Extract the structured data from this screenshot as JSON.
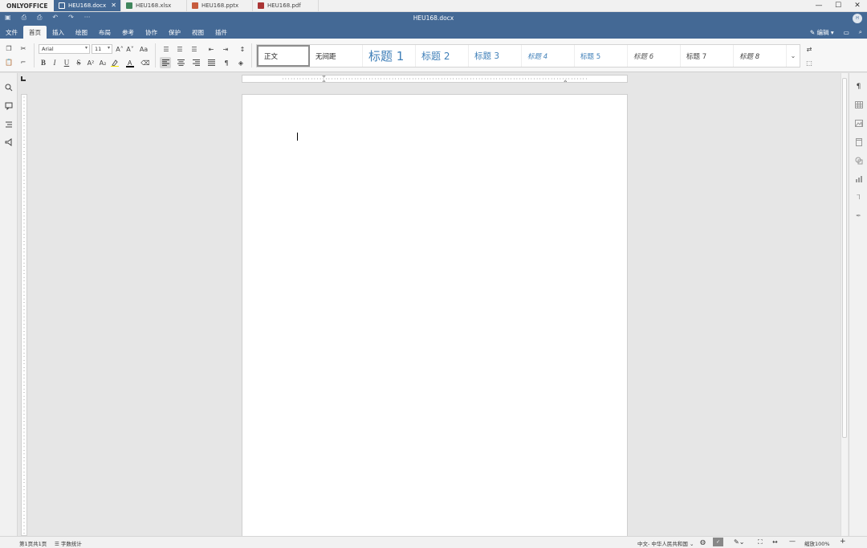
{
  "app": {
    "brand": "ONLYOFFICE"
  },
  "tabs": [
    {
      "label": "HEU168.docx",
      "type": "docx",
      "color": "#446995",
      "active": true
    },
    {
      "label": "HEU168.xlsx",
      "type": "xlsx",
      "color": "#40865c"
    },
    {
      "label": "HEU168.pptx",
      "type": "pptx",
      "color": "#c75b3d"
    },
    {
      "label": "HEU168.pdf",
      "type": "pdf",
      "color": "#aa3535"
    }
  ],
  "window": {
    "title": "HEU168.docx",
    "more": "···",
    "avatar": "H"
  },
  "menu": {
    "items": [
      "文件",
      "首页",
      "插入",
      "绘图",
      "布局",
      "参考",
      "协作",
      "保护",
      "视图",
      "插件"
    ],
    "active": "首页",
    "edit_mode": "编辑"
  },
  "toolbar": {
    "font_name": "Arial",
    "font_size": "11",
    "bold": "B",
    "italic": "I",
    "underline": "U",
    "strike": "S",
    "superscript": "A²",
    "subscript": "A₂",
    "grow": "A˄",
    "shrink": "A˅",
    "case": "Aa"
  },
  "styles": [
    {
      "label": "正文"
    },
    {
      "label": "无间距"
    },
    {
      "label": "标题 1"
    },
    {
      "label": "标题 2"
    },
    {
      "label": "标题 3"
    },
    {
      "label": "标题 4"
    },
    {
      "label": "标题 5"
    },
    {
      "label": "标题 6"
    },
    {
      "label": "标题 7"
    },
    {
      "label": "标题 8"
    }
  ],
  "status": {
    "page": "第1页共1页",
    "word_count": "字数统计",
    "language": "中文- 中华人民共和国",
    "zoom": "缩放100%"
  },
  "colors": {
    "accent": "#446995",
    "page": "#ffffff",
    "canvas": "#e6e6e6"
  }
}
